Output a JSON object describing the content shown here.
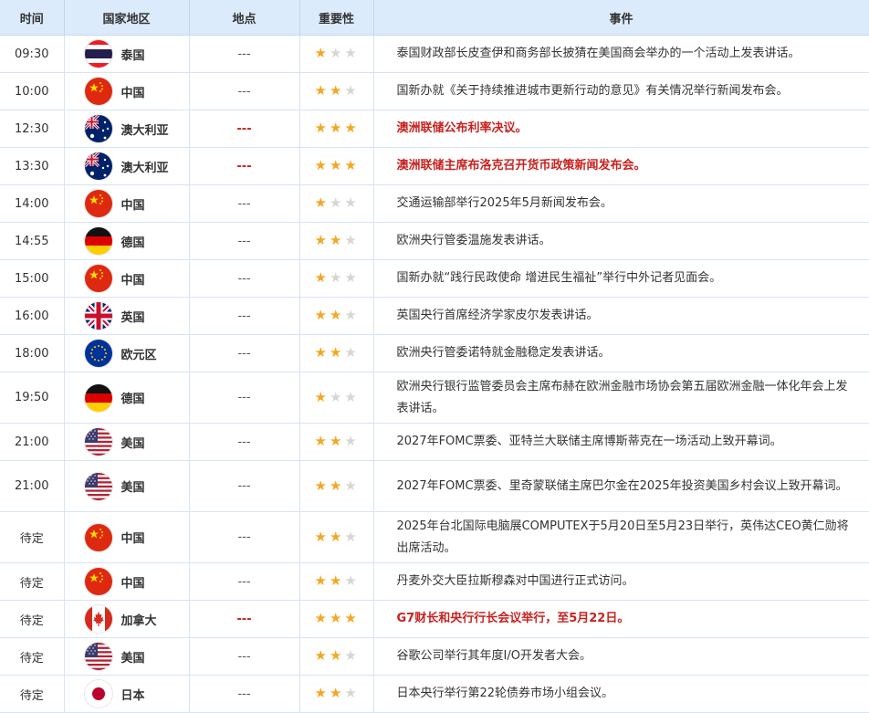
{
  "header": {
    "time": "时间",
    "country": "国家地区",
    "location": "地点",
    "importance": "重要性",
    "event": "事件"
  },
  "colors": {
    "header_bg": "#dcebfb",
    "star_on": "#f5a623",
    "star_off": "#d6d6d6",
    "highlight_red": "#c8221f"
  },
  "rows": [
    {
      "time": "09:30",
      "country": "泰国",
      "flag": "thailand-flag-icon",
      "location": "---",
      "stars": 1,
      "event": "泰国财政部长皮查伊和商务部长披猜在美国商会举办的一个活动上发表讲话。",
      "highlight": false
    },
    {
      "time": "10:00",
      "country": "中国",
      "flag": "china-flag-icon",
      "location": "---",
      "stars": 2,
      "event": "国新办就《关于持续推进城市更新行动的意见》有关情况举行新闻发布会。",
      "highlight": false
    },
    {
      "time": "12:30",
      "country": "澳大利亚",
      "flag": "australia-flag-icon",
      "location": "---",
      "stars": 3,
      "event": "澳洲联储公布利率决议。",
      "highlight": true
    },
    {
      "time": "13:30",
      "country": "澳大利亚",
      "flag": "australia-flag-icon",
      "location": "---",
      "stars": 3,
      "event": "澳洲联储主席布洛克召开货币政策新闻发布会。",
      "highlight": true
    },
    {
      "time": "14:00",
      "country": "中国",
      "flag": "china-flag-icon",
      "location": "---",
      "stars": 1,
      "event": "交通运输部举行2025年5月新闻发布会。",
      "highlight": false
    },
    {
      "time": "14:55",
      "country": "德国",
      "flag": "germany-flag-icon",
      "location": "---",
      "stars": 2,
      "event": "欧洲央行管委温施发表讲话。",
      "highlight": false
    },
    {
      "time": "15:00",
      "country": "中国",
      "flag": "china-flag-icon",
      "location": "---",
      "stars": 1,
      "event": "国新办就“践行民政使命 增进民生福祉”举行中外记者见面会。",
      "highlight": false
    },
    {
      "time": "16:00",
      "country": "英国",
      "flag": "uk-flag-icon",
      "location": "---",
      "stars": 2,
      "event": "英国央行首席经济学家皮尔发表讲话。",
      "highlight": false
    },
    {
      "time": "18:00",
      "country": "欧元区",
      "flag": "eu-flag-icon",
      "location": "---",
      "stars": 2,
      "event": "欧洲央行管委诺特就金融稳定发表讲话。",
      "highlight": false
    },
    {
      "time": "19:50",
      "country": "德国",
      "flag": "germany-flag-icon",
      "location": "---",
      "stars": 1,
      "event": "欧洲央行银行监管委员会主席布赫在欧洲金融市场协会第五届欧洲金融一体化年会上发表讲话。",
      "highlight": false
    },
    {
      "time": "21:00",
      "country": "美国",
      "flag": "usa-flag-icon",
      "location": "---",
      "stars": 2,
      "event": "2027年FOMC票委、亚特兰大联储主席博斯蒂克在一场活动上致开幕词。",
      "highlight": false
    },
    {
      "time": "21:00",
      "country": "美国",
      "flag": "usa-flag-icon",
      "location": "---",
      "stars": 2,
      "event": "2027年FOMC票委、里奇蒙联储主席巴尔金在2025年投资美国乡村会议上致开幕词。",
      "highlight": false
    },
    {
      "time": "待定",
      "country": "中国",
      "flag": "china-flag-icon",
      "location": "---",
      "stars": 2,
      "event": "2025年台北国际电脑展COMPUTEX于5月20日至5月23日举行，英伟达CEO黄仁勋将出席活动。",
      "highlight": false
    },
    {
      "time": "待定",
      "country": "中国",
      "flag": "china-flag-icon",
      "location": "---",
      "stars": 2,
      "event": "丹麦外交大臣拉斯穆森对中国进行正式访问。",
      "highlight": false
    },
    {
      "time": "待定",
      "country": "加拿大",
      "flag": "canada-flag-icon",
      "location": "---",
      "stars": 3,
      "event": "G7财长和央行行长会议举行，至5月22日。",
      "highlight": true
    },
    {
      "time": "待定",
      "country": "美国",
      "flag": "usa-flag-icon",
      "location": "---",
      "stars": 2,
      "event": "谷歌公司举行其年度I/O开发者大会。",
      "highlight": false
    },
    {
      "time": "待定",
      "country": "日本",
      "flag": "japan-flag-icon",
      "location": "---",
      "stars": 2,
      "event": "日本央行举行第22轮债券市场小组会议。",
      "highlight": false
    }
  ]
}
